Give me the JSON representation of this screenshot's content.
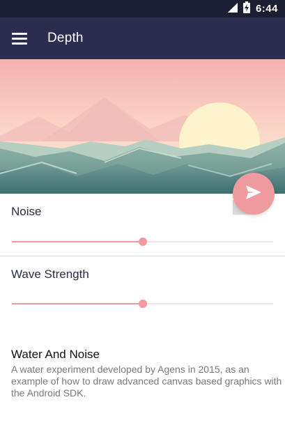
{
  "status_bar": {
    "time": "6:44",
    "icons": [
      "signal-icon",
      "battery-charging-icon"
    ]
  },
  "app_bar": {
    "title": "Depth",
    "menu_icon": "hamburger-menu-icon"
  },
  "fab": {
    "icon": "send-icon",
    "color": "#ef9a9e"
  },
  "controls": {
    "noise": {
      "label": "Noise",
      "value": 0.5
    },
    "wave_strength": {
      "label": "Wave Strength",
      "value": 0.5
    }
  },
  "info": {
    "title": "Water And Noise",
    "description": "A water experiment developed by Agens in 2015, as an example of how to draw advanced canvas based graphics with the Android SDK."
  },
  "colors": {
    "status_bar": "#1c1e33",
    "app_bar": "#2c2e4f",
    "accent": "#ef9a9e",
    "accent_light": "#f8e1e3"
  }
}
